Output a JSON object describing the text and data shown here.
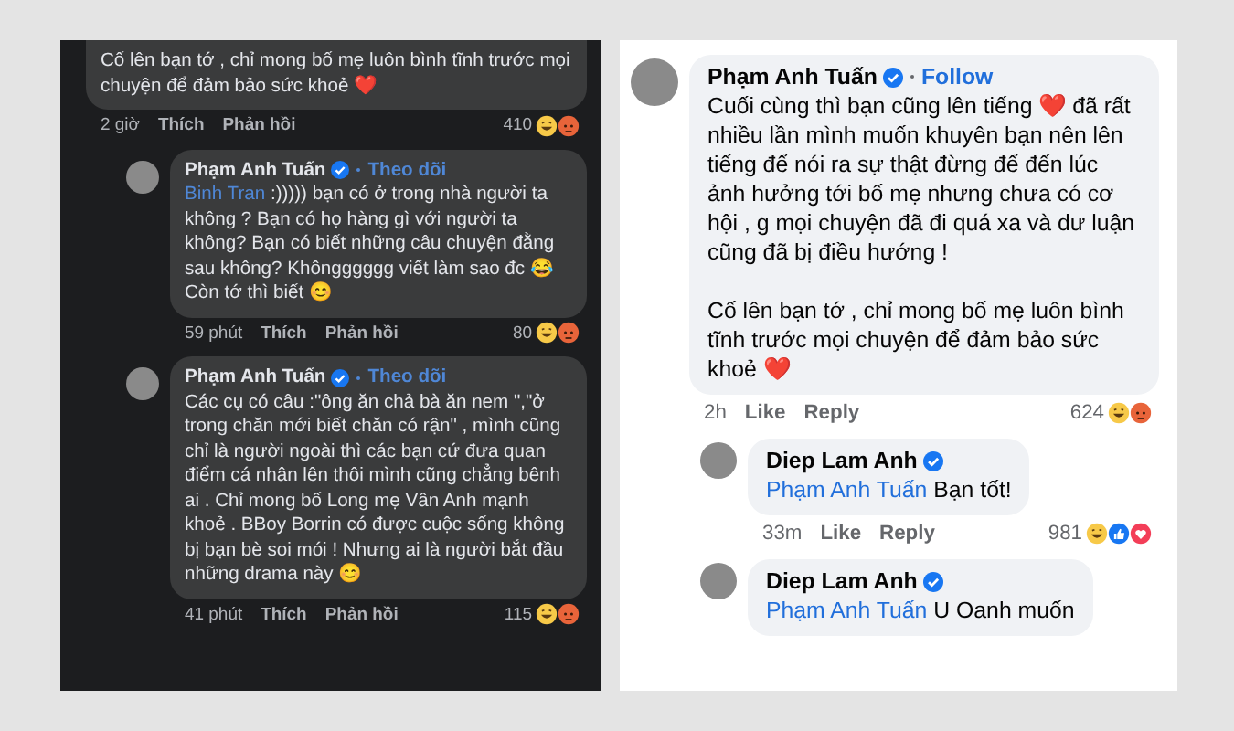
{
  "panels": [
    {
      "kind": "dark",
      "comments": [
        {
          "nested": false,
          "text": "Cố lên bạn tớ , chỉ mong bố mẹ luôn bình tĩnh trước mọi chuyện để đảm bảo sức khoẻ ❤️",
          "time": "2 giờ",
          "like": "Thích",
          "reply": "Phản hồi",
          "count": "410",
          "reactions": [
            {
              "kind": "haha"
            },
            {
              "kind": "angry"
            }
          ]
        },
        {
          "nested": true,
          "author": "Phạm Anh Tuấn",
          "verified": true,
          "follow": "Theo dõi",
          "mention": "Binh Tran",
          "text": ":))))) bạn có ở trong nhà người ta không ? Bạn có họ hàng gì với người ta không? Bạn có biết những câu chuyện đằng sau không? Khôngggggg viết làm sao đc 😂\nCòn tớ thì biết 😊",
          "time": "59 phút",
          "like": "Thích",
          "reply": "Phản hồi",
          "count": "80",
          "reactions": [
            {
              "kind": "haha"
            },
            {
              "kind": "angry"
            }
          ]
        },
        {
          "nested": true,
          "author": "Phạm Anh Tuấn",
          "verified": true,
          "follow": "Theo dõi",
          "text": "Các cụ có câu :\"ông ăn chả bà ăn nem \",\"ở trong chăn mới biết chăn có rận\" , mình cũng chỉ là người ngoài thì các bạn cứ đưa quan điểm cá nhân lên thôi mình cũng chẳng bênh ai . Chỉ mong bố Long mẹ Vân Anh mạnh khoẻ . BBoy Borrin có được cuộc sống không bị bạn bè soi mói ! Nhưng ai là người bắt đầu những drama này 😊",
          "time": "41 phút",
          "like": "Thích",
          "reply": "Phản hồi",
          "count": "115",
          "reactions": [
            {
              "kind": "haha"
            },
            {
              "kind": "angry"
            }
          ]
        }
      ]
    },
    {
      "kind": "light",
      "comments": [
        {
          "nested": false,
          "author": "Phạm Anh Tuấn",
          "verified": true,
          "follow": "Follow",
          "text": "Cuối cùng thì bạn cũng lên tiếng ❤️ đã rất nhiều lần mình muốn khuyên bạn nên lên tiếng để nói ra sự thật đừng để đến lúc ảnh hưởng tới bố mẹ nhưng chưa có cơ hội , g mọi chuyện đã đi quá xa và dư luận cũng đã bị điều hướng !\n\nCố lên bạn tớ , chỉ mong bố mẹ luôn bình tĩnh trước mọi chuyện để đảm bảo sức khoẻ ❤️",
          "time": "2h",
          "like": "Like",
          "reply": "Reply",
          "count": "624",
          "reactions": [
            {
              "kind": "haha"
            },
            {
              "kind": "angry"
            }
          ]
        },
        {
          "nested": true,
          "author": "Diep Lam Anh",
          "verified": true,
          "mention": "Phạm Anh Tuấn",
          "text": "Bạn tốt!",
          "time": "33m",
          "like": "Like",
          "reply": "Reply",
          "count": "981",
          "reactions": [
            {
              "kind": "haha"
            },
            {
              "kind": "like"
            },
            {
              "kind": "love"
            }
          ]
        },
        {
          "nested": true,
          "author": "Diep Lam Anh",
          "verified": true,
          "mention": "Phạm Anh Tuấn",
          "text": "U Oanh muốn"
        }
      ]
    }
  ]
}
